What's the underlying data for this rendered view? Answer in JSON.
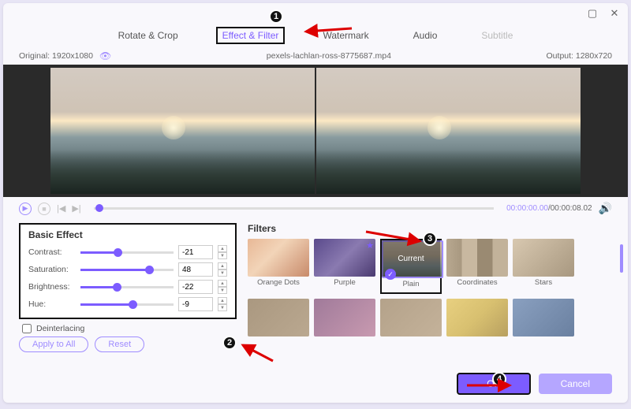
{
  "window": {
    "title": ""
  },
  "tabs": {
    "rotate": "Rotate & Crop",
    "effect": "Effect & Filter",
    "watermark": "Watermark",
    "audio": "Audio",
    "subtitle": "Subtitle"
  },
  "info": {
    "original_label": "Original: 1920x1080",
    "filename": "pexels-lachlan-ross-8775687.mp4",
    "output_label": "Output: 1280x720"
  },
  "playback": {
    "current": "00:00:00.00",
    "duration": "00:00:08.02"
  },
  "basic": {
    "heading": "Basic Effect",
    "rows": [
      {
        "label": "Contrast:",
        "value": "-21",
        "pct": 40
      },
      {
        "label": "Saturation:",
        "value": "48",
        "pct": 74
      },
      {
        "label": "Brightness:",
        "value": "-22",
        "pct": 39
      },
      {
        "label": "Hue:",
        "value": "-9",
        "pct": 56
      }
    ],
    "deinterlacing": "Deinterlacing",
    "apply": "Apply to All",
    "reset": "Reset"
  },
  "filters": {
    "heading": "Filters",
    "current_label": "Current",
    "row1": [
      {
        "name": "Orange Dots"
      },
      {
        "name": "Purple"
      },
      {
        "name": "Plain"
      },
      {
        "name": "Coordinates"
      },
      {
        "name": "Stars"
      }
    ]
  },
  "footer": {
    "ok": "OK",
    "cancel": "Cancel"
  },
  "badges": {
    "b1": "1",
    "b2": "2",
    "b3": "3",
    "b4": "4"
  }
}
